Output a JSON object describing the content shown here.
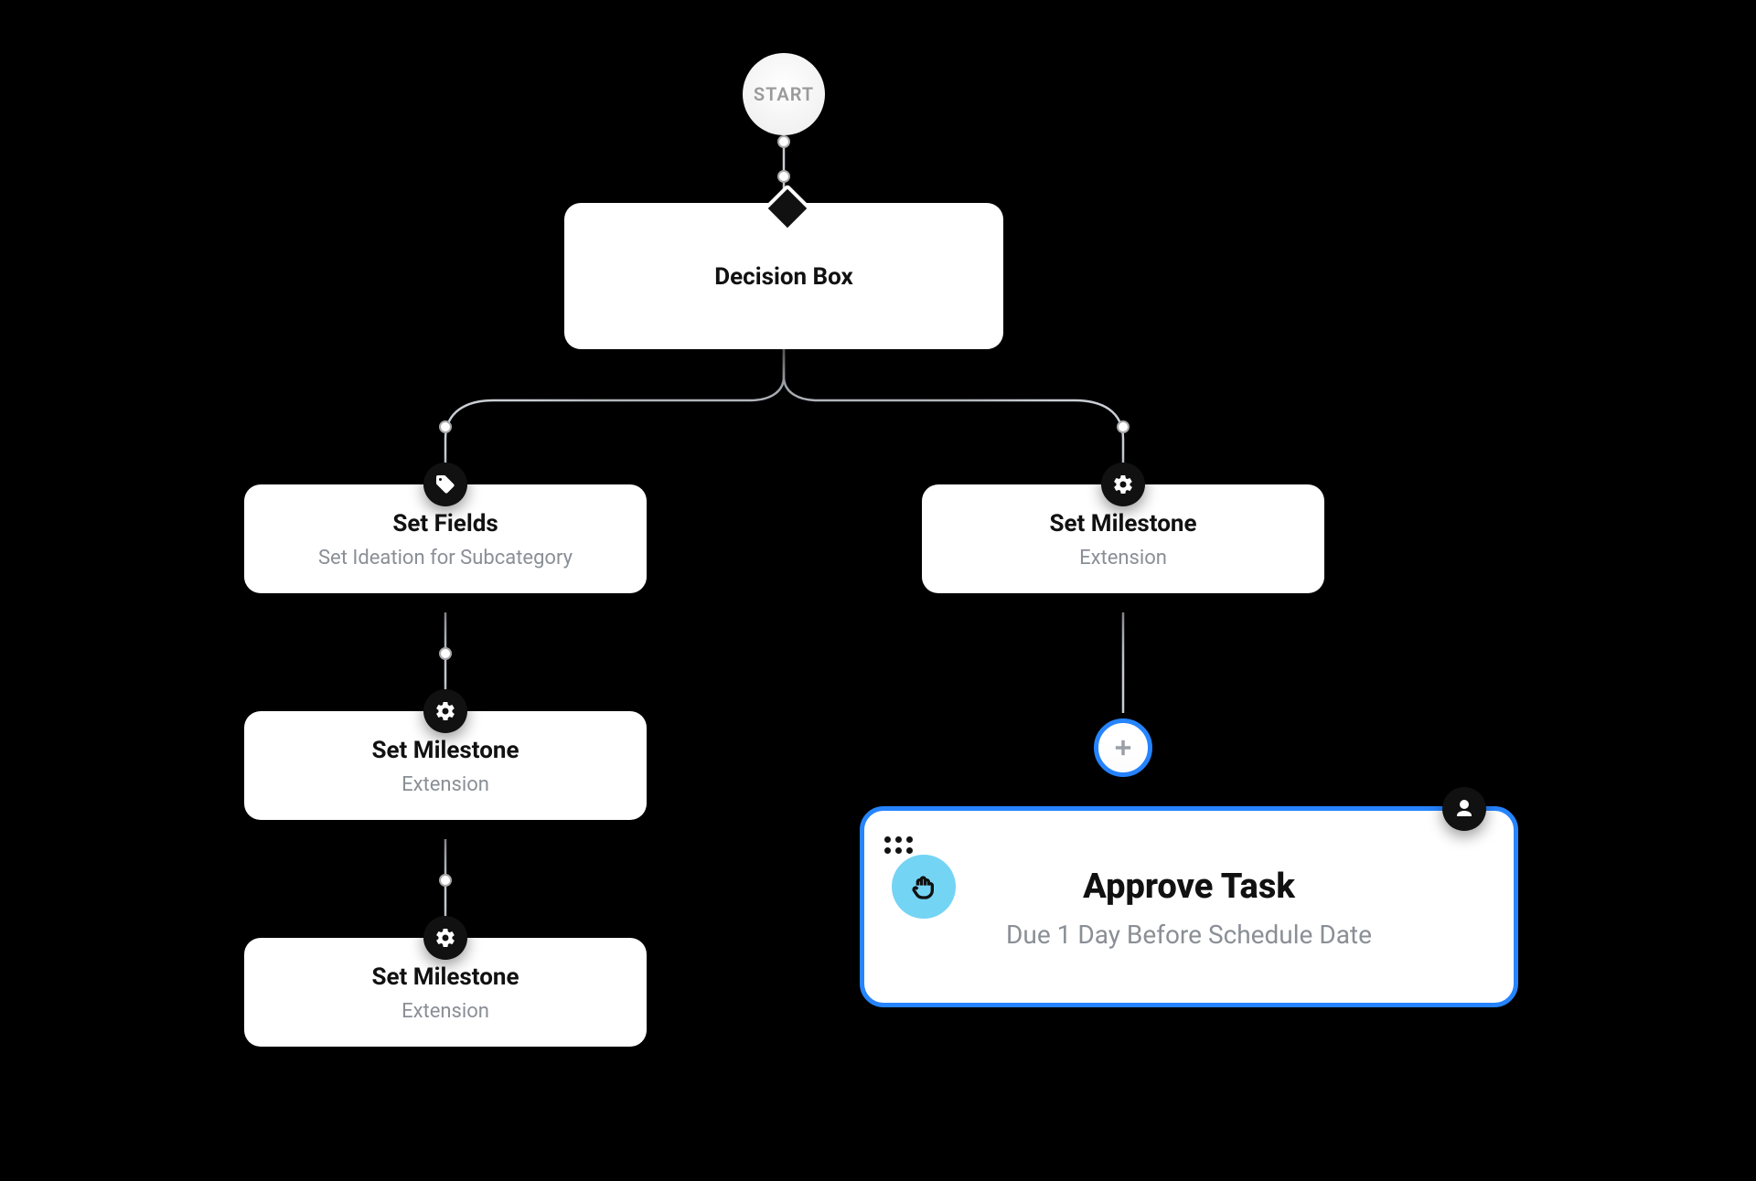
{
  "start": {
    "label": "START"
  },
  "decision": {
    "title": "Decision Box"
  },
  "left_branch": {
    "set_fields": {
      "title": "Set Fields",
      "sub": "Set Ideation for Subcategory"
    },
    "milestone1": {
      "title": "Set Milestone",
      "sub": "Extension"
    },
    "milestone2": {
      "title": "Set Milestone",
      "sub": "Extension"
    }
  },
  "right_branch": {
    "milestone": {
      "title": "Set Milestone",
      "sub": "Extension"
    },
    "approve": {
      "title": "Approve Task",
      "sub": "Due 1 Day Before Schedule Date"
    }
  }
}
